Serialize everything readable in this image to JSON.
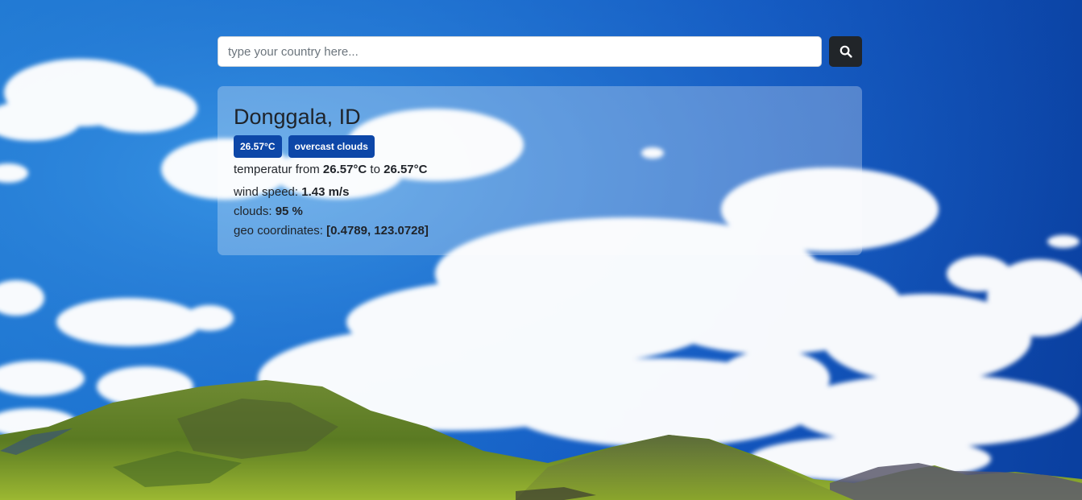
{
  "search": {
    "placeholder": "type your country here...",
    "value": "",
    "button_icon": "search-icon"
  },
  "weather": {
    "location": "Donggala, ID",
    "badges": {
      "temperature": "26.57°C",
      "description": "overcast clouds"
    },
    "temperature_range": {
      "label": "temperatur from",
      "min": "26.57°C",
      "connector": "to",
      "max": "26.57°C"
    },
    "wind_speed": {
      "label": "wind speed:",
      "value": "1.43 m/s"
    },
    "clouds": {
      "label": "clouds:",
      "value": "95 %"
    },
    "geo_coordinates": {
      "label": "geo coordinates:",
      "value": "[0.4789, 123.0728]"
    }
  },
  "colors": {
    "sky_light": "#2f8be0",
    "sky_dark": "#0a3f9f",
    "badge": "#0d47a8",
    "search_button": "#212529"
  }
}
